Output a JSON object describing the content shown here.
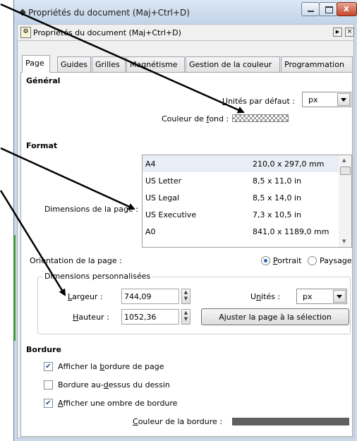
{
  "window": {
    "title": "Propriétés du document (Maj+Ctrl+D)",
    "panel_title": "Propriétés du document (Maj+Ctrl+D)"
  },
  "tabs": [
    {
      "label": "Page",
      "active": true
    },
    {
      "label": "Guides"
    },
    {
      "label": "Grilles"
    },
    {
      "label": "Magnétisme"
    },
    {
      "label": "Gestion de la couleur"
    },
    {
      "label": "Programmation"
    }
  ],
  "general": {
    "heading": "Général",
    "units_label_u": "U",
    "units_label_rest": "nités par défaut :",
    "units_value": "px",
    "bg_label_pre": "Couleur de ",
    "bg_label_u": "f",
    "bg_label_post": "ond :"
  },
  "format": {
    "heading": "Format",
    "dimensions_label": "Dimensions de la page :",
    "sizes": [
      {
        "name": "A4",
        "dims": "210,0 x 297,0 mm"
      },
      {
        "name": "US Letter",
        "dims": "8,5 x 11,0 in"
      },
      {
        "name": "US Legal",
        "dims": "8,5 x 14,0 in"
      },
      {
        "name": "US Executive",
        "dims": "7,3 x 10,5 in"
      },
      {
        "name": "A0",
        "dims": "841,0 x 1189,0 mm"
      }
    ],
    "orientation_label": "Orientation de la page :",
    "portrait_u": "P",
    "portrait_rest": "ortrait",
    "paysage": "Paysage",
    "custom_title": "Dimensions personnalisées",
    "width_u": "L",
    "width_rest": "argeur :",
    "width_value": "744,09",
    "height_u": "H",
    "height_rest": "auteur :",
    "height_value": "1052,36",
    "units_pre": "U",
    "units_u": "n",
    "units_post": "ités :",
    "units_value": "px",
    "fit_button": "Ajuster la page à la sélection"
  },
  "border": {
    "heading": "Bordure",
    "show_border_pre": "Afficher la ",
    "show_border_u": "b",
    "show_border_post": "ordure de page",
    "border_on_top_pre": "Bordure au-",
    "border_on_top_u": "d",
    "border_on_top_post": "essus du dessin",
    "show_shadow_u": "A",
    "show_shadow_post": "fficher une ombre de bordure",
    "border_color_u": "C",
    "border_color_post": "ouleur de la bordure :"
  },
  "colors": {
    "border_color": "#5f5f5f",
    "radio_accent": "#2c62b5"
  }
}
